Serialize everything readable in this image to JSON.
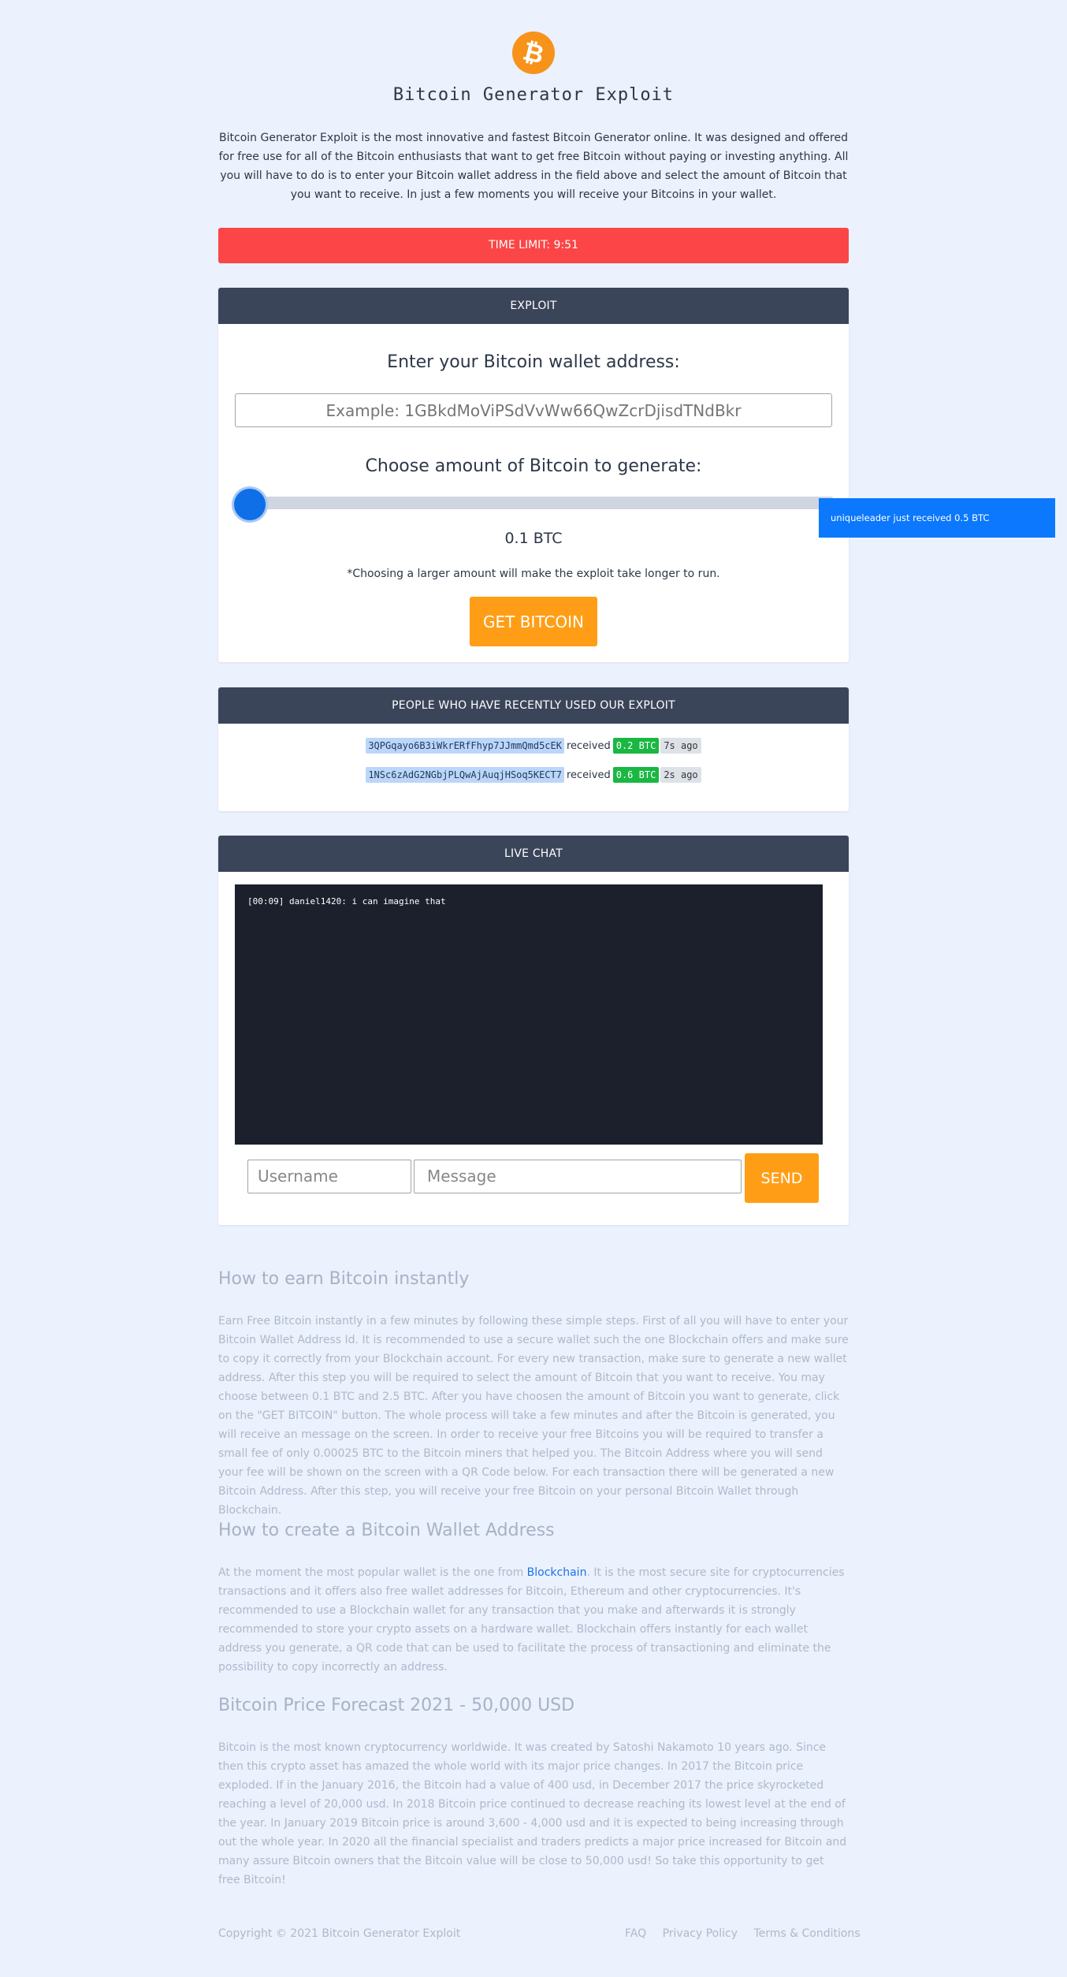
{
  "header": {
    "logo_glyph": "₿",
    "title": "Bitcoin Generator Exploit",
    "intro": "Bitcoin Generator Exploit is the most innovative and fastest Bitcoin Generator online. It was designed and offered for free use for all of the Bitcoin enthusiasts that want to get free Bitcoin without paying or investing anything. All you will have to do is to enter your Bitcoin wallet address in the field above and select the amount of Bitcoin that you want to receive. In just a few moments you will receive your Bitcoins in your wallet."
  },
  "timer": {
    "label": "TIME LIMIT: 9:51"
  },
  "exploit": {
    "header": "EXPLOIT",
    "wallet_label": "Enter your Bitcoin wallet address:",
    "wallet_placeholder": "Example: 1GBkdMoViPSdVvWw66QwZcrDjisdTNdBkr",
    "amount_label": "Choose amount of Bitcoin to generate:",
    "slider_value_fraction": 0.0,
    "amount_display": "0.1 BTC",
    "note": "*Choosing a larger amount will make the exploit take longer to run.",
    "button": "GET BITCOIN"
  },
  "toast": {
    "text": "uniqueleader just received 0.5 BTC"
  },
  "recent": {
    "header": "PEOPLE WHO HAVE RECENTLY USED OUR EXPLOIT",
    "rows": [
      {
        "address": "3QPGqayo6B3iWkrERfFhyp7JJmmQmd5cEK",
        "verb": "received",
        "amount": "0.2 BTC",
        "ago": "7s ago"
      },
      {
        "address": "1NSc6zAdG2NGbjPLQwAjAuqjHSoq5KECT7",
        "verb": "received",
        "amount": "0.6 BTC",
        "ago": "2s ago"
      }
    ]
  },
  "chat": {
    "header": "LIVE CHAT",
    "messages": [
      "[00:09] daniel1420: i can imagine that"
    ],
    "username_placeholder": "Username",
    "message_placeholder": "Message",
    "send": "SEND"
  },
  "articles": [
    {
      "title": "How to earn Bitcoin instantly",
      "body": "Earn Free Bitcoin instantly in a few minutes by following these simple steps. First of all you will have to enter your Bitcoin Wallet Address Id. It is recommended to use a secure wallet such the one Blockchain offers and make sure to copy it correctly from your Blockchain account. For every new transaction, make sure to generate a new wallet address. After this step you will be required to select the amount of Bitcoin that you want to receive. You may choose between 0.1 BTC and 2.5 BTC. After you have choosen the amount of Bitcoin you want to generate, click on the \"GET BITCOIN\" button. The whole process will take a few minutes and after the Bitcoin is generated, you will receive an message on the screen. In order to receive your free Bitcoins you will be required to transfer a small fee of only 0.00025 BTC to the Bitcoin miners that helped you. The Bitcoin Address where you will send your fee will be shown on the screen with a QR Code below. For each transaction there will be generated a new Bitcoin Address. After this step, you will receive your free Bitcoin on your personal Bitcoin Wallet through Blockchain."
    },
    {
      "title": "How to create a Bitcoin Wallet Address",
      "body_before": "At the moment the most popular wallet is the one from ",
      "link": "Blockchain",
      "body_after": ". It is the most secure site for cryptocurrencies transactions and it offers also free wallet addresses for Bitcoin, Ethereum and other cryptocurrencies. It's recommended to use a Blockchain wallet for any transaction that you make and afterwards it is strongly recommended to store your crypto assets on a hardware wallet. Blockchain offers instantly for each wallet address you generate, a QR code that can be used to facilitate the process of transactioning and eliminate the possibility to copy incorrectly an address."
    },
    {
      "title": "Bitcoin Price Forecast 2021 - 50,000 USD",
      "body": "Bitcoin is the most known cryptocurrency worldwide. It was created by Satoshi Nakamoto 10 years ago. Since then this crypto asset has amazed the whole world with its major price changes. In 2017 the Bitcoin price exploded. If in the January 2016, the Bitcoin had a value of 400 usd, in December 2017 the price skyrocketed reaching a level of 20,000 usd. In 2018 Bitcoin price continued to decrease reaching its lowest level at the end of the year. In January 2019 Bitcoin price is around 3,600 - 4,000 usd and it is expected to being increasing through out the whole year. In 2020 all the financial specialist and traders predicts a major price increased for Bitcoin and many assure Bitcoin owners that the Bitcoin value will be close to 50,000 usd! So take this opportunity to get free Bitcoin!"
    }
  ],
  "footer": {
    "copyright": "Copyright © 2021 Bitcoin Generator Exploit",
    "links": [
      "FAQ",
      "Privacy Policy",
      "Terms & Conditions"
    ]
  },
  "colors": {
    "background": "#ebf1fd",
    "accent_orange": "#ff9e16",
    "timer_red": "#fc4546",
    "card_header": "#3b4559",
    "toast_blue": "#0b78fd",
    "amount_green": "#1ab743"
  }
}
